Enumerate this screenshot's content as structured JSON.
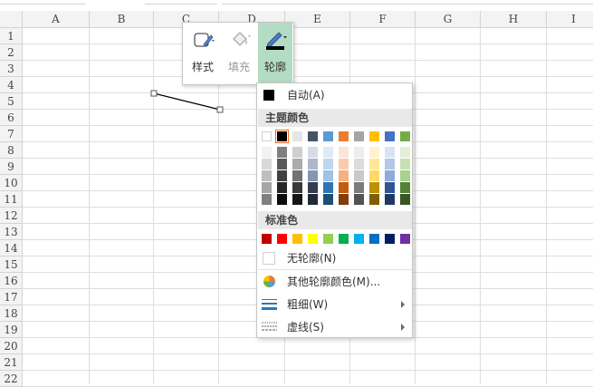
{
  "columns": [
    "A",
    "B",
    "C",
    "D",
    "E",
    "F",
    "G",
    "H",
    "I"
  ],
  "rows": [
    "1",
    "2",
    "3",
    "4",
    "5",
    "6",
    "7",
    "8",
    "9",
    "10",
    "11",
    "12",
    "13",
    "14",
    "15",
    "16",
    "17",
    "18",
    "19",
    "20",
    "21",
    "22"
  ],
  "mini_toolbar": {
    "style_label": "样式",
    "fill_label": "填充",
    "outline_label": "轮廓"
  },
  "menu": {
    "auto_label": "自动(A)",
    "theme_colors_label": "主题颜色",
    "standard_colors_label": "标准色",
    "no_outline_label": "无轮廓(N)",
    "more_colors_label": "其他轮廓颜色(M)...",
    "weight_label": "粗细(W)",
    "dashes_label": "虚线(S)"
  },
  "theme_colors": [
    "#ffffff",
    "#000000",
    "#e7e6e6",
    "#44546a",
    "#5b9bd5",
    "#ed7d31",
    "#a5a5a5",
    "#ffc000",
    "#4472c4",
    "#70ad47"
  ],
  "theme_shades": [
    [
      "#f2f2f2",
      "#d9d9d9",
      "#bfbfbf",
      "#a6a6a6",
      "#808080"
    ],
    [
      "#7f7f7f",
      "#595959",
      "#404040",
      "#262626",
      "#0d0d0d"
    ],
    [
      "#d0cece",
      "#aeabab",
      "#757171",
      "#3a3838",
      "#171616"
    ],
    [
      "#d6dce5",
      "#adb9ca",
      "#8497b0",
      "#333f50",
      "#222a35"
    ],
    [
      "#deebf7",
      "#bdd7ee",
      "#9dc3e6",
      "#2e75b6",
      "#1f4e79"
    ],
    [
      "#fbe5d6",
      "#f8cbad",
      "#f4b183",
      "#c55a11",
      "#843c0c"
    ],
    [
      "#ededed",
      "#dbdbdb",
      "#c9c9c9",
      "#7b7b7b",
      "#525252"
    ],
    [
      "#fff2cc",
      "#ffe699",
      "#ffd966",
      "#bf9000",
      "#7f6000"
    ],
    [
      "#dae3f3",
      "#b4c7e7",
      "#8faadc",
      "#2f5597",
      "#203864"
    ],
    [
      "#e2f0d9",
      "#c5e0b4",
      "#a9d18e",
      "#548235",
      "#385723"
    ]
  ],
  "standard_colors": [
    "#c00000",
    "#ff0000",
    "#ffc000",
    "#ffff00",
    "#92d050",
    "#00b050",
    "#00b0f0",
    "#0070c0",
    "#002060",
    "#7030a0"
  ],
  "selected_theme_index": 1,
  "accent_color": "#b4dbc3"
}
